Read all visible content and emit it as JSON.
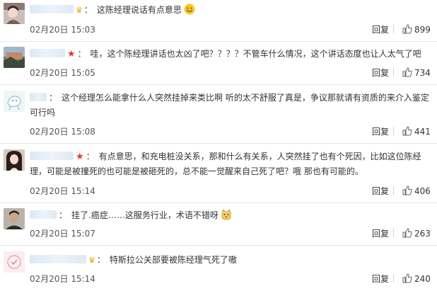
{
  "comments": [
    {
      "name_redacted": true,
      "badge": "crown",
      "separator": "：",
      "text": "这陈经理说话有点意思",
      "trailing_emoji": "smile-emoji",
      "time": "02月20日 15:03",
      "reply_label": "回复",
      "likes": "899"
    },
    {
      "name_redacted": true,
      "badge": "star",
      "separator": "：",
      "text": "哇，这个陈经理讲话也太凶了吧？？？？不管车什么情况，这个讲话态度也让人太气了吧",
      "time": "02月20日 15:05",
      "reply_label": "回复",
      "likes": "734"
    },
    {
      "name_redacted": true,
      "badge": "",
      "separator": "：",
      "text": "这个经理怎么能拿什么人突然挂掉来类比啊 听的太不舒服了真是，争议那就请有资质的来介入鉴定可行吗",
      "time": "02月20日 15:08",
      "reply_label": "回复",
      "likes": "441"
    },
    {
      "name_redacted": true,
      "badge": "star",
      "separator": "：",
      "text": "有点意思，和充电桩没关系，那和什么有关系，人突然挂了也有个死因，比如这位陈经理，可能是被撞死的也可能是被砸死的，总不能一觉醒来自己死了吧？哦 那也有可能的。",
      "time": "02月20日 15:14",
      "reply_label": "回复",
      "likes": "406"
    },
    {
      "name_redacted": true,
      "badge": "",
      "separator": "：",
      "text": "挂了.癌症……这服务行业，术语不错呀",
      "trailing_emoji": "cat-emoji",
      "time": "02月20日 15:07",
      "reply_label": "回复",
      "likes": "263"
    },
    {
      "name_redacted": true,
      "badge": "crown",
      "separator": "：",
      "text": "特斯拉公关部要被陈经理气死了嗷",
      "time": "02月20日 15:14",
      "reply_label": "回复",
      "likes": "240"
    }
  ]
}
